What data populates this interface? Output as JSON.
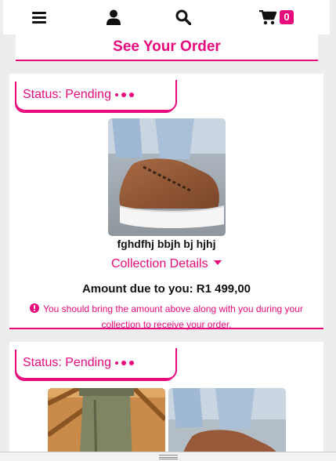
{
  "nav": {
    "cart_count": "0",
    "icons": [
      "menu-icon",
      "user-icon",
      "search-icon",
      "cart-icon"
    ]
  },
  "page": {
    "title": "See Your Order"
  },
  "colors": {
    "accent": "#e8097c"
  },
  "orders": [
    {
      "status": "Status: Pending",
      "product_name": "fghdfhj bbjh bj hjhj",
      "collection_label": "Collection Details",
      "amount_text": "Amount due to you: R1 499,00",
      "notice": "You should bring the amount above along with you during your collection to receive your order."
    },
    {
      "status": "Status: Pending"
    }
  ]
}
